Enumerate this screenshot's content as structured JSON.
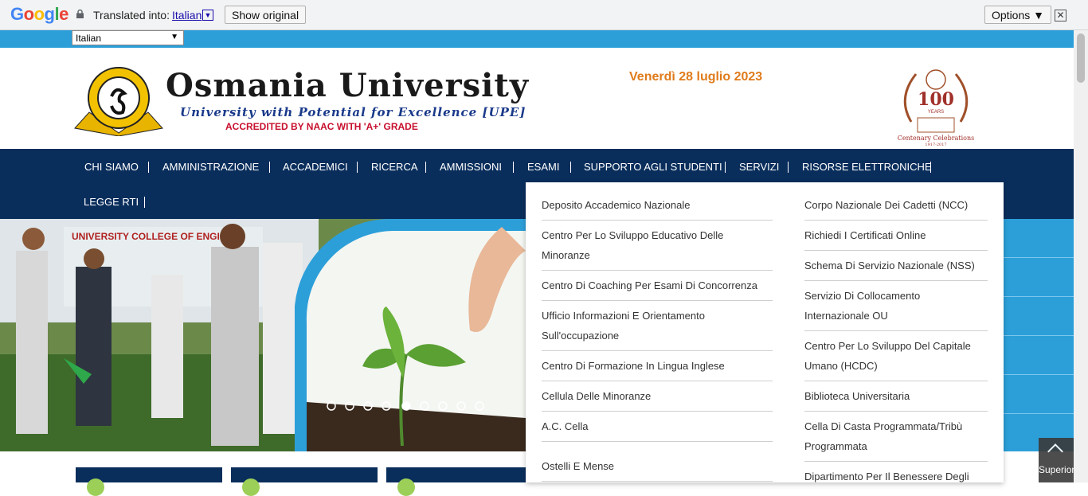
{
  "translate_bar": {
    "logo": "Google",
    "translated_into": "Translated into:",
    "language": "Italian",
    "show_original": "Show original",
    "options": "Options ▼",
    "close": "✕"
  },
  "language_select": {
    "value": "Italian"
  },
  "header": {
    "university_name": "Osmania University",
    "tagline": "University with Potential for Excellence [UPE]",
    "accreditation": "ACCREDITED BY NAAC WITH 'A+' GRADE",
    "date": "Venerdì 28 luglio 2023",
    "centenary_number": "100",
    "centenary_years": "YEARS",
    "centenary_label": "Centenary Celebrations",
    "centenary_range": "1917-2017"
  },
  "nav": {
    "items": [
      "CHI SIAMO",
      "AMMINISTRAZIONE",
      "ACCADEMICI",
      "RICERCA",
      "AMMISSIONI",
      "ESAMI",
      "SUPPORTO AGLI STUDENTI",
      "SERVIZI",
      "RISORSE ELETTRONICHE",
      "LEGGE RTI"
    ]
  },
  "banner": {
    "sign_text": "UNIVERSITY COLLEGE OF ENGI",
    "slide_count": 9,
    "active_slide": 5
  },
  "dropdown": {
    "left": [
      "Deposito Accademico Nazionale",
      "Centro Per Lo Sviluppo Educativo Delle Minoranze",
      "Centro Di Coaching Per Esami Di Concorrenza",
      "Ufficio Informazioni E Orientamento Sull'occupazione",
      "Centro Di Formazione In Lingua Inglese",
      "Cellula Delle Minoranze",
      "A.C. Cella",
      "Ostelli E Mense"
    ],
    "right": [
      "Corpo Nazionale Dei Cadetti (NCC)",
      "Richiedi I Certificati Online",
      "Schema Di Servizio Nazionale (NSS)",
      "Servizio Di Collocamento Internazionale OU",
      "Centro Per Lo Sviluppo Del Capitale Umano (HCDC)",
      "Biblioteca Universitaria",
      "Cella Di Casta Programmata/Tribù Programmata",
      "Dipartimento Per Il Benessere Degli"
    ]
  },
  "scroll_top": {
    "label": "Superiore"
  },
  "colors": {
    "nav_bg": "#0a2e5c",
    "accent_blue": "#2c9fd9",
    "date_orange": "#e07b1a",
    "naac_red": "#c8102e"
  }
}
